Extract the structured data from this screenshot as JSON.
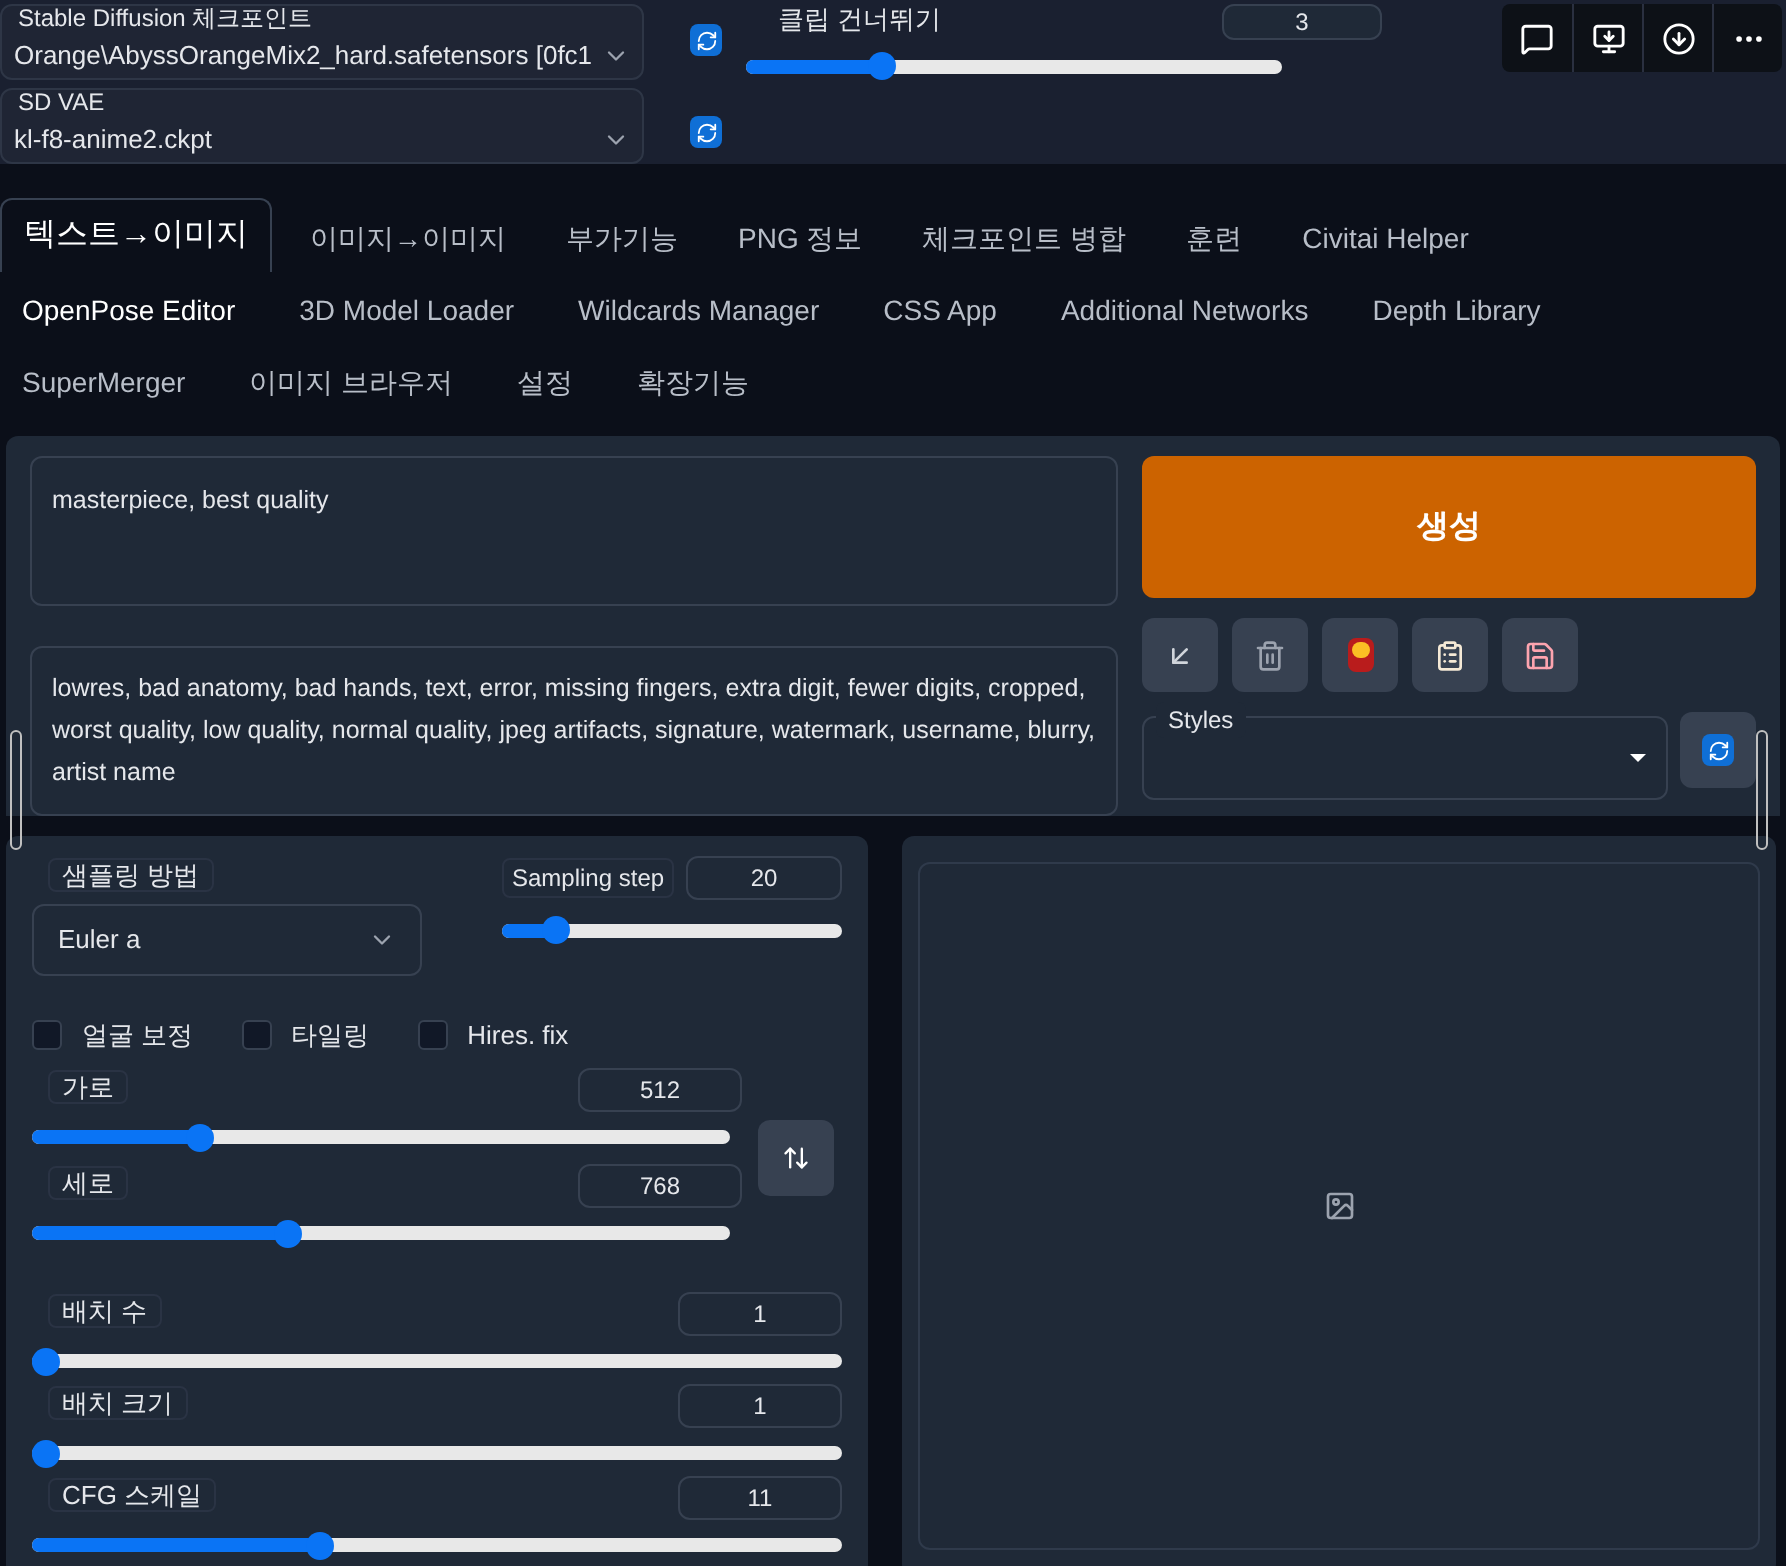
{
  "checkpoint": {
    "label": "Stable Diffusion 체크포인트",
    "value": "Orange\\AbyssOrangeMix2_hard.safetensors [0fc1"
  },
  "vae": {
    "label": "SD VAE",
    "value": "kl-f8-anime2.ckpt"
  },
  "clip_skip": {
    "label": "클립 건너뛰기",
    "value": "3",
    "level": 0.24
  },
  "tab_rows": [
    [
      {
        "label": "텍스트→이미지",
        "selected": true
      },
      {
        "label": "이미지→이미지",
        "selected": false
      },
      {
        "label": "부가기능",
        "selected": false
      },
      {
        "label": "PNG 정보",
        "selected": false
      },
      {
        "label": "체크포인트 병합",
        "selected": false
      },
      {
        "label": "훈련",
        "selected": false
      },
      {
        "label": "Civitai Helper",
        "selected": false
      }
    ],
    [
      {
        "label": "OpenPose Editor",
        "selected": false
      },
      {
        "label": "3D Model Loader",
        "selected": false
      },
      {
        "label": "Wildcards Manager",
        "selected": false
      },
      {
        "label": "CSS App",
        "selected": false
      },
      {
        "label": "Additional Networks",
        "selected": false
      },
      {
        "label": "Depth Library",
        "selected": false
      }
    ],
    [
      {
        "label": "SuperMerger",
        "selected": false
      },
      {
        "label": "이미지 브라우저",
        "selected": false
      },
      {
        "label": "설정",
        "selected": false
      },
      {
        "label": "확장기능",
        "selected": false
      }
    ]
  ],
  "prompt": "masterpiece, best quality",
  "negative_prompt": "lowres, bad anatomy, bad hands, text, error, missing fingers, extra digit, fewer digits, cropped, worst quality, low quality, normal quality, jpeg artifacts, signature, watermark, username, blurry, artist name",
  "generate_button": "생성",
  "styles": {
    "label": "Styles"
  },
  "sampler": {
    "label": "샘플링 방법",
    "value": "Euler a"
  },
  "sampling_steps": {
    "label": "Sampling step",
    "value": "20",
    "level": 0.13
  },
  "checkboxes": [
    {
      "label": "얼굴 보정",
      "checked": false
    },
    {
      "label": "타일링",
      "checked": false
    },
    {
      "label": "Hires. fix",
      "checked": false
    }
  ],
  "width": {
    "label": "가로",
    "value": "512",
    "level": 0.23
  },
  "height": {
    "label": "세로",
    "value": "768",
    "level": 0.36
  },
  "sliders": [
    {
      "label": "배치 수",
      "value": "1",
      "level": 0
    },
    {
      "label": "배치 크기",
      "value": "1",
      "level": 0
    },
    {
      "label": "CFG 스케일",
      "value": "11",
      "level": 0.35
    }
  ]
}
